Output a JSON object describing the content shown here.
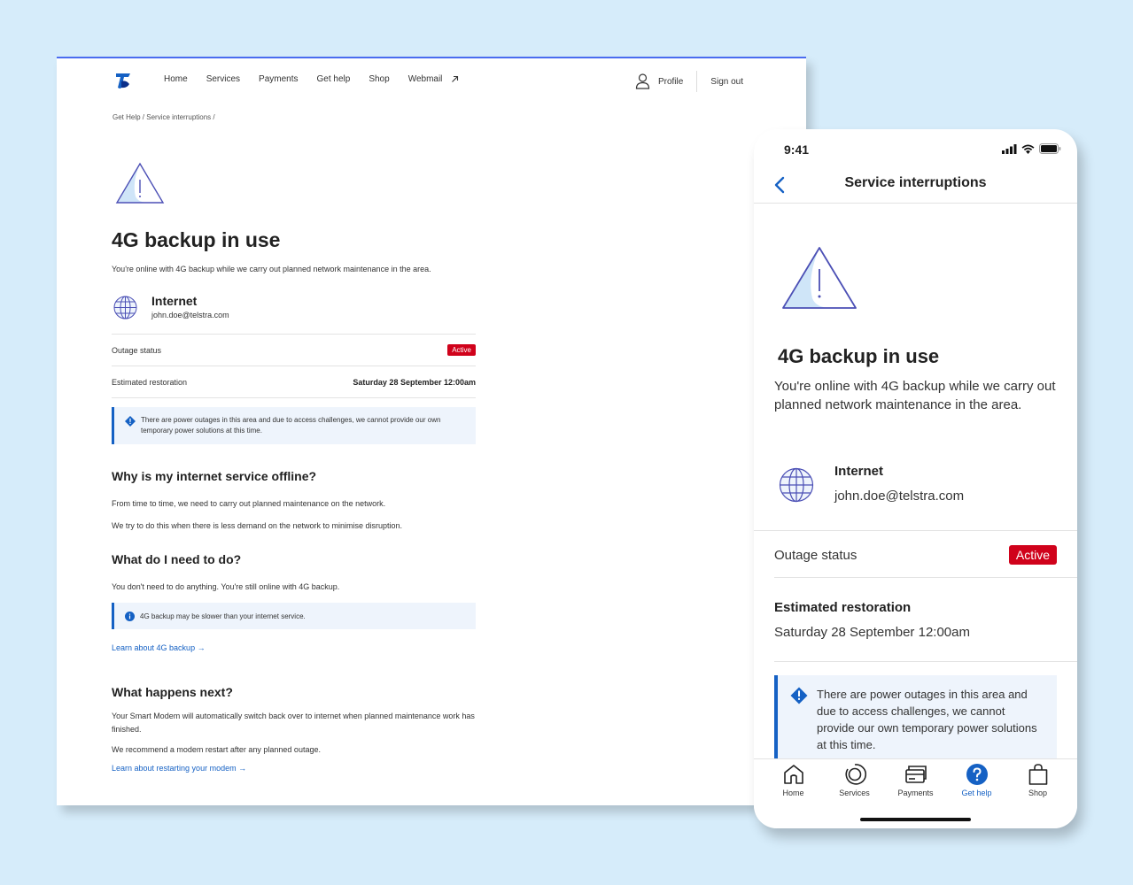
{
  "desktop": {
    "nav": {
      "links": [
        "Home",
        "Services",
        "Payments",
        "Get help",
        "Shop"
      ],
      "webmail": "Webmail",
      "profile": "Profile",
      "sign_out": "Sign out"
    },
    "breadcrumb": "Get Help / Service interruptions /",
    "title": "4G backup in use",
    "subtitle": "You're online with 4G backup while we carry out planned network maintenance in the area.",
    "service": {
      "name": "Internet",
      "email": "john.doe@telstra.com"
    },
    "outage_label": "Outage status",
    "outage_value": "Active",
    "restoration_label": "Estimated restoration",
    "restoration_value": "Saturday 28 September 12:00am",
    "notice": "There are power outages in this area and due to access challenges, we cannot provide our own temporary power solutions at this time.",
    "why_heading": "Why is my internet service offline?",
    "why_p1": "From time to time, we need to carry out planned maintenance on the network.",
    "why_p2": "We try to do this when there is less demand on the network to minimise disruption.",
    "todo_heading": "What do I need to do?",
    "todo_p1": "You don't need to do anything. You're still online with 4G backup.",
    "todo_note": "4G backup may be slower than your internet service.",
    "todo_link": "Learn about 4G backup →",
    "next_heading": "What happens next?",
    "next_p1": "Your Smart Modem will automatically switch back over to internet when planned maintenance work has finished.",
    "next_p2": "We recommend a modem restart after any planned outage.",
    "next_link": "Learn about restarting your modem →"
  },
  "mobile": {
    "time": "9:41",
    "header_title": "Service interruptions",
    "title": "4G backup in use",
    "subtitle": "You're online with 4G backup while we carry out planned network maintenance in the area.",
    "service": {
      "name": "Internet",
      "email": "john.doe@telstra.com"
    },
    "outage_label": "Outage status",
    "outage_value": "Active",
    "restoration_label": "Estimated restoration",
    "restoration_value": "Saturday 28 September 12:00am",
    "notice": "There are power outages in this area and due to access challenges, we cannot provide our own temporary power solutions at this time.",
    "tabs": [
      "Home",
      "Services",
      "Payments",
      "Get help",
      "Shop"
    ],
    "active_tab": "Get help"
  },
  "colors": {
    "brand_blue": "#1561c4",
    "alert_red": "#d0021b",
    "background": "#d6ecfa"
  }
}
